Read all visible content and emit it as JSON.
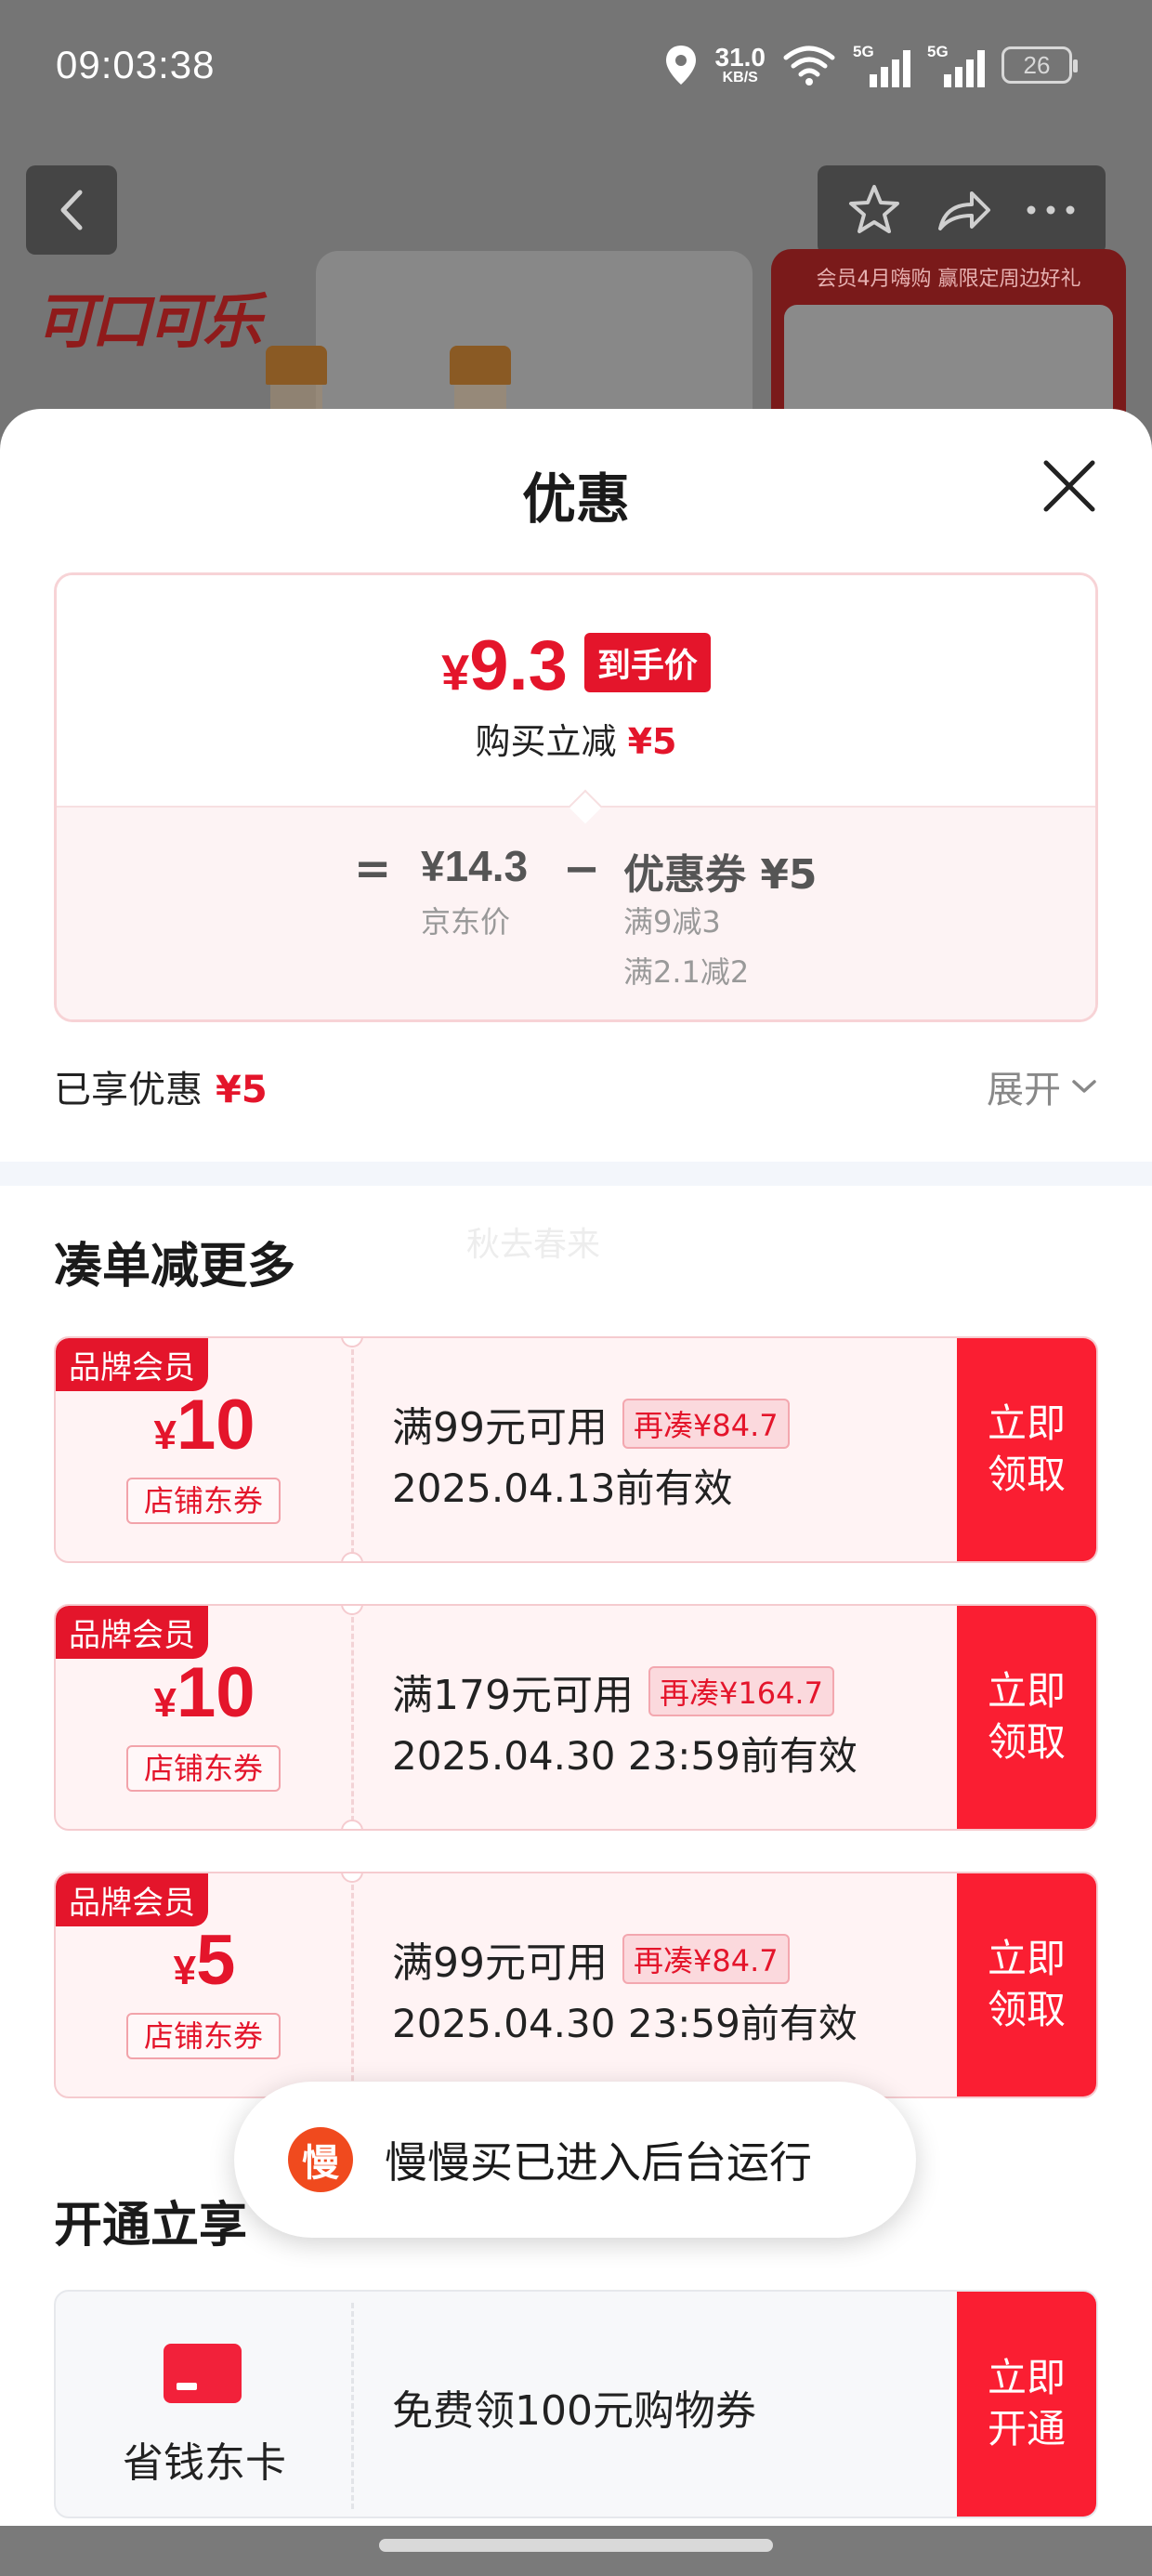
{
  "status_bar": {
    "time": "09:03:38",
    "net_speed_value": "31.0",
    "net_speed_unit": "KB/S",
    "sim1_label": "5G",
    "sim2_label": "5G",
    "battery": "26"
  },
  "product_page": {
    "brand_logo": "可口可乐",
    "promo_title": "会员4月嗨购 赢限定周边好礼"
  },
  "sheet": {
    "title": "优惠",
    "summary": {
      "final_symbol": "¥",
      "final_price": "9.3",
      "final_label": "到手价",
      "reduce_label": "购买立减",
      "reduce_amount": "¥5",
      "equals": "=",
      "jd_price": "¥14.3",
      "jd_price_label": "京东价",
      "minus": "−",
      "coupon_label": "优惠券 ¥5",
      "coupon_rule_1": "满9减3",
      "coupon_rule_2": "满2.1减2"
    },
    "enjoyed_label": "已享优惠",
    "enjoyed_amount": "¥5",
    "expand_label": "展开",
    "more_section_title": "凑单减更多",
    "watermark": "秋去春来",
    "coupons": [
      {
        "tag": "品牌会员",
        "symbol": "¥",
        "amount": "10",
        "type": "店铺东券",
        "condition": "满99元可用",
        "gap": "再凑¥84.7",
        "validity": "2025.04.13前有效",
        "claim_line1": "立即",
        "claim_line2": "领取"
      },
      {
        "tag": "品牌会员",
        "symbol": "¥",
        "amount": "10",
        "type": "店铺东券",
        "condition": "满179元可用",
        "gap": "再凑¥164.7",
        "validity": "2025.04.30 23:59前有效",
        "claim_line1": "立即",
        "claim_line2": "领取"
      },
      {
        "tag": "品牌会员",
        "symbol": "¥",
        "amount": "5",
        "type": "店铺东券",
        "condition": "满99元可用",
        "gap": "再凑¥84.7",
        "validity": "2025.04.30 23:59前有效",
        "claim_line1": "立即",
        "claim_line2": "领取"
      }
    ],
    "open_section_title": "开通立享",
    "card_offer": {
      "name": "省钱东卡",
      "description": "免费领100元购物券",
      "open_line1": "立即",
      "open_line2": "开通"
    }
  },
  "toast": {
    "icon_char": "慢",
    "text": "慢慢买已进入后台运行"
  },
  "colors": {
    "accent_red": "#e4152b",
    "claim_button_red": "#fa1e32"
  }
}
